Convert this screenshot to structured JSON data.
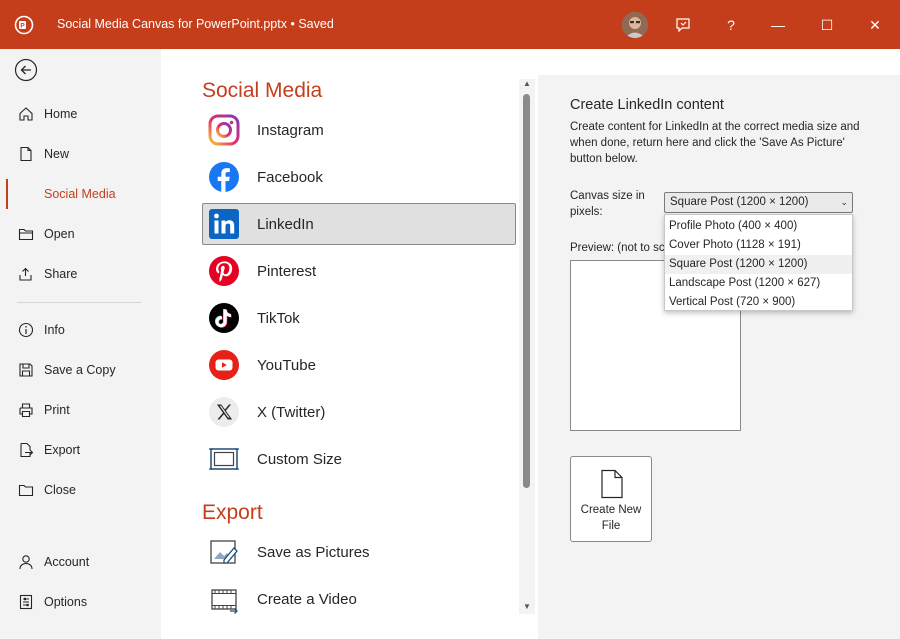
{
  "titlebar": {
    "title": "Social Media Canvas for PowerPoint.pptx",
    "separator": "•",
    "status": "Saved",
    "help": "?",
    "minimize": "—",
    "maximize": "☐",
    "close": "✕",
    "accent": "#c43e1c"
  },
  "sidebar": {
    "items": [
      {
        "label": "Home",
        "icon": "home-icon"
      },
      {
        "label": "New",
        "icon": "new-doc-icon"
      },
      {
        "label": "Social Media",
        "icon": "none"
      },
      {
        "label": "Open",
        "icon": "folder-icon"
      },
      {
        "label": "Share",
        "icon": "share-icon"
      },
      {
        "label": "Info",
        "icon": "info-icon"
      },
      {
        "label": "Save a Copy",
        "icon": "save-copy-icon"
      },
      {
        "label": "Print",
        "icon": "print-icon"
      },
      {
        "label": "Export",
        "icon": "export-icon"
      },
      {
        "label": "Close",
        "icon": "folder-close-icon"
      },
      {
        "label": "Account",
        "icon": "person-icon"
      },
      {
        "label": "Options",
        "icon": "options-icon"
      }
    ],
    "active": "Social Media"
  },
  "middle": {
    "social_title": "Social Media",
    "social_items": [
      {
        "label": "Instagram",
        "icon": "instagram-icon"
      },
      {
        "label": "Facebook",
        "icon": "facebook-icon"
      },
      {
        "label": "LinkedIn",
        "icon": "linkedin-icon"
      },
      {
        "label": "Pinterest",
        "icon": "pinterest-icon"
      },
      {
        "label": "TikTok",
        "icon": "tiktok-icon"
      },
      {
        "label": "YouTube",
        "icon": "youtube-icon"
      },
      {
        "label": "X (Twitter)",
        "icon": "x-icon"
      },
      {
        "label": "Custom Size",
        "icon": "custom-size-icon"
      }
    ],
    "selected": "LinkedIn",
    "export_title": "Export",
    "export_items": [
      {
        "label": "Save as Pictures",
        "icon": "save-pictures-icon"
      },
      {
        "label": "Create a Video",
        "icon": "video-icon"
      }
    ]
  },
  "right": {
    "heading": "Create LinkedIn content",
    "description": "Create content for LinkedIn at the correct media size and when done, return here and click the 'Save As Picture' button below.",
    "canvas_label": "Canvas size in pixels:",
    "selected_size": "Square Post (1200 × 1200)",
    "options": [
      "Profile Photo (400 × 400)",
      "Cover Photo (1128 × 191)",
      "Square Post (1200 × 1200)",
      "Landscape Post (1200 × 627)",
      "Vertical Post (720 × 900)"
    ],
    "preview_label": "Preview: (not to sc",
    "create_label": "Create New File"
  }
}
